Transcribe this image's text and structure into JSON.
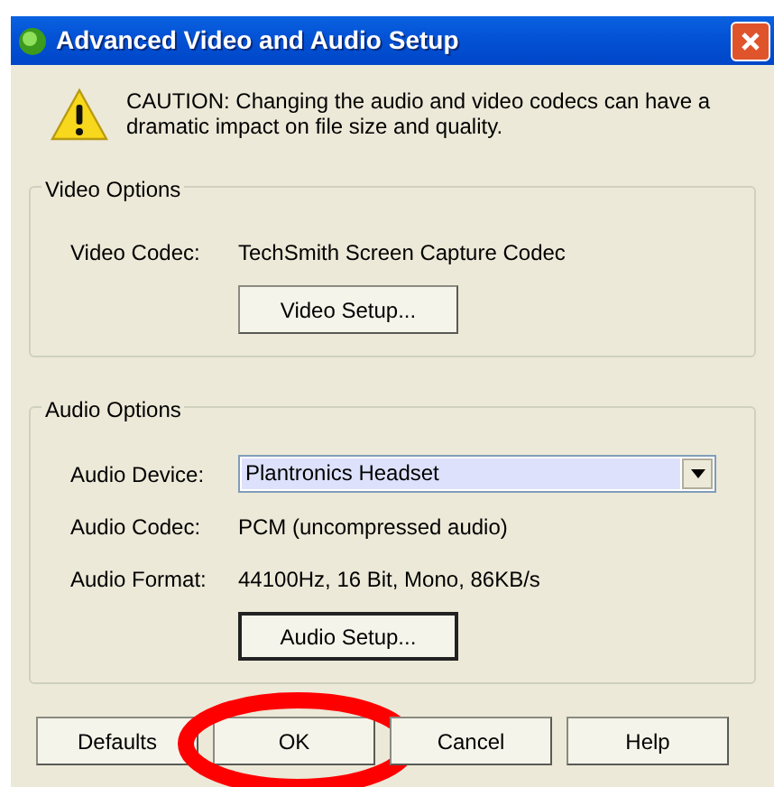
{
  "window": {
    "title": "Advanced Video and Audio Setup"
  },
  "caution": "CAUTION: Changing the audio and video codecs can have a dramatic impact on file size and quality.",
  "groups": [
    {
      "title": "Video Options",
      "rows": [
        {
          "kind": "text",
          "label": "Video Codec:",
          "value": "TechSmith Screen Capture Codec"
        }
      ],
      "button": {
        "label": "Video Setup...",
        "default": false
      }
    },
    {
      "title": "Audio Options",
      "rows": [
        {
          "kind": "dropdown",
          "label": "Audio Device:",
          "value": "Plantronics Headset"
        },
        {
          "kind": "text",
          "label": "Audio Codec:",
          "value": "PCM (uncompressed audio)"
        },
        {
          "kind": "text",
          "label": "Audio Format:",
          "value": "44100Hz, 16 Bit, Mono, 86KB/s"
        }
      ],
      "button": {
        "label": "Audio Setup...",
        "default": true
      }
    }
  ],
  "buttons": [
    {
      "label": "Defaults",
      "circled": false
    },
    {
      "label": "OK",
      "circled": true
    },
    {
      "label": "Cancel",
      "circled": false
    },
    {
      "label": "Help",
      "circled": false
    }
  ]
}
